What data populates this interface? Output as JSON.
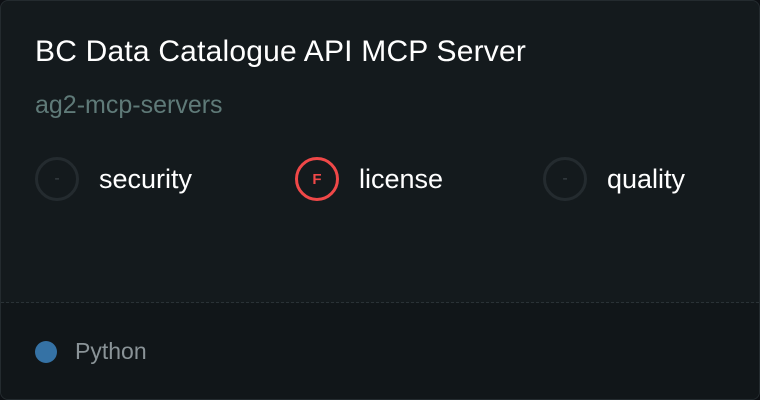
{
  "card": {
    "title": "BC Data Catalogue API MCP Server",
    "repo": "ag2-mcp-servers"
  },
  "scores": {
    "security": {
      "grade": "-",
      "label": "security"
    },
    "license": {
      "grade": "F",
      "label": "license",
      "color": "#f04848"
    },
    "quality": {
      "grade": "-",
      "label": "quality"
    }
  },
  "footer": {
    "language": "Python",
    "language_color": "#3572a5"
  }
}
